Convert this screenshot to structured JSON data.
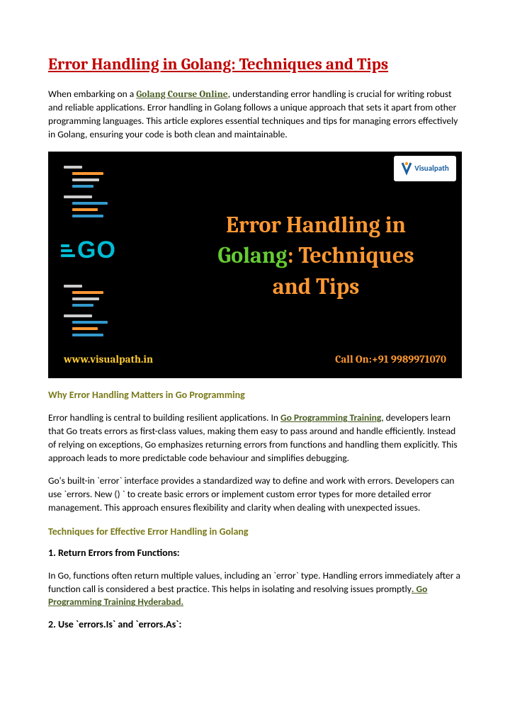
{
  "title": "Error Handling in Golang: Techniques and Tips",
  "intro": {
    "t1": "When embarking on a ",
    "link": "Golang Course Online",
    "t2": ", understanding error handling is crucial for writing robust and reliable applications. Error handling in Golang follows a unique approach that sets it apart from other programming languages. This article explores essential techniques and tips for managing errors effectively in Golang, ensuring your code is both clean and maintainable."
  },
  "banner": {
    "logo": "Visualpath",
    "go": "GO",
    "headline1": "Error Handling in",
    "headline2a": "Golang",
    "headline2b": ": Techniques",
    "headline3": "and Tips",
    "url": "www.visualpath.in",
    "phone": "Call On:+91 9989971070"
  },
  "sect1": {
    "heading": "Why Error Handling Matters in Go Programming",
    "p1a": "Error handling is central to building resilient applications. In ",
    "p1link": "Go Programming Training",
    "p1b": ", developers learn that Go treats errors as first-class values, making them easy to pass around and handle efficiently. Instead of relying on exceptions, Go emphasizes returning errors from functions and handling them explicitly. This approach leads to more predictable code behaviour and simplifies debugging.",
    "p2": "Go's built-in `error` interface provides a standardized way to define and work with errors. Developers can use `errors. New () ` to create basic errors or implement custom error types for more detailed error management. This approach ensures flexibility and clarity when dealing with unexpected issues."
  },
  "sect2": {
    "heading": "Techniques for Effective Error Handling in Golang",
    "sub1": "1. Return Errors from Functions:",
    "p1a": "In Go, functions often return multiple values, including an `error` type. Handling errors immediately after a function call is considered a best practice. This helps in isolating and resolving issues promptly",
    "p1link": ". Go Programming Training Hyderabad.",
    "sub2": "2. Use `errors.Is` and `errors.As`:"
  }
}
